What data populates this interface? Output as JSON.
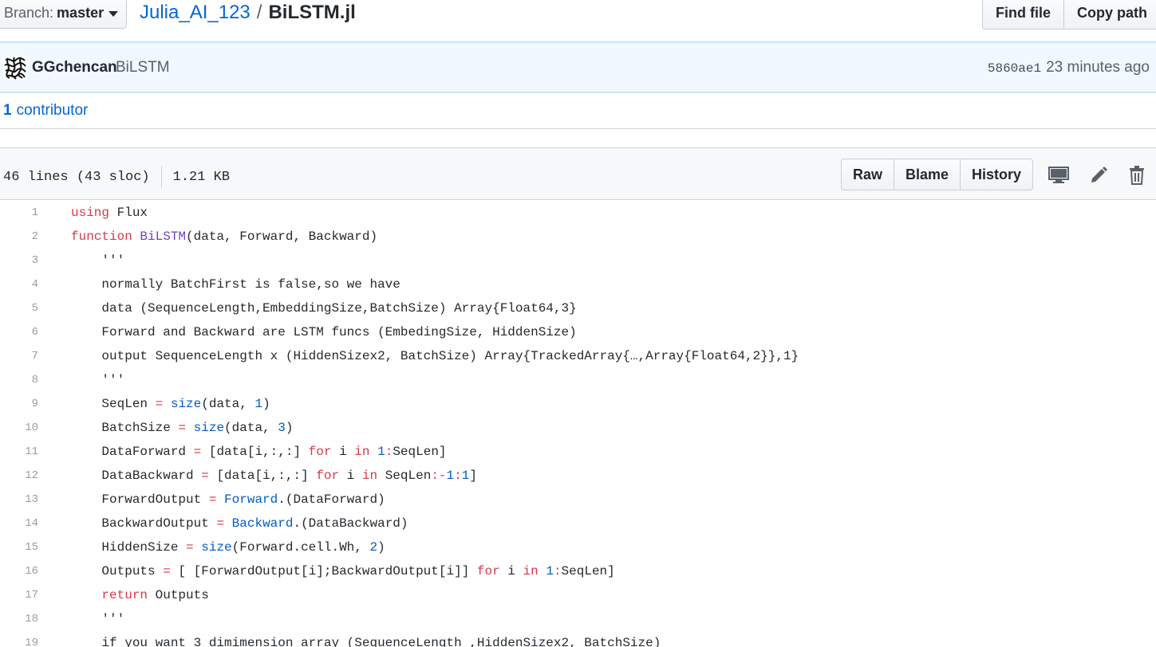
{
  "header": {
    "branch_label": "Branch:",
    "branch_value": "master",
    "repo": "Julia_AI_123",
    "separator": "/",
    "file": "BiLSTM.jl",
    "find_file": "Find file",
    "copy_path": "Copy path"
  },
  "commit": {
    "author": "GGchencan",
    "message": "BiLSTM",
    "sha": "5860ae1",
    "time": "23 minutes ago"
  },
  "contributors": {
    "count": "1",
    "label": "contributor"
  },
  "file_header": {
    "lines": "46 lines (43 sloc)",
    "size": "1.21 KB",
    "raw": "Raw",
    "blame": "Blame",
    "history": "History",
    "icons": [
      "desktop-icon",
      "pencil-icon",
      "trash-icon"
    ]
  },
  "colors": {
    "link": "#0366d6",
    "keyword": "#d73a49",
    "function": "#6f42c1",
    "constant": "#005cc5",
    "commit_bg": "#f1f8ff"
  },
  "code_lines": [
    [
      {
        "t": "k",
        "v": "using"
      },
      {
        "t": "",
        "v": " Flux"
      }
    ],
    [
      {
        "t": "k",
        "v": "function"
      },
      {
        "t": "",
        "v": " "
      },
      {
        "t": "f",
        "v": "BiLSTM"
      },
      {
        "t": "",
        "v": "(data, Forward, Backward)"
      }
    ],
    [
      {
        "t": "",
        "v": "    '''"
      }
    ],
    [
      {
        "t": "",
        "v": "    normally BatchFirst is false,so we have"
      }
    ],
    [
      {
        "t": "",
        "v": "    data (SequenceLength,EmbeddingSize,BatchSize) Array{Float64,3}"
      }
    ],
    [
      {
        "t": "",
        "v": "    Forward and Backward are LSTM funcs (EmbedingSize, HiddenSize)"
      }
    ],
    [
      {
        "t": "",
        "v": "    output SequenceLength x (HiddenSizex2, BatchSize) Array{TrackedArray{…,Array{Float64,2}},1}"
      }
    ],
    [
      {
        "t": "",
        "v": "    '''"
      }
    ],
    [
      {
        "t": "",
        "v": "    SeqLen "
      },
      {
        "t": "k",
        "v": "="
      },
      {
        "t": "",
        "v": " "
      },
      {
        "t": "c",
        "v": "size"
      },
      {
        "t": "",
        "v": "(data, "
      },
      {
        "t": "c",
        "v": "1"
      },
      {
        "t": "",
        "v": ")"
      }
    ],
    [
      {
        "t": "",
        "v": "    BatchSize "
      },
      {
        "t": "k",
        "v": "="
      },
      {
        "t": "",
        "v": " "
      },
      {
        "t": "c",
        "v": "size"
      },
      {
        "t": "",
        "v": "(data, "
      },
      {
        "t": "c",
        "v": "3"
      },
      {
        "t": "",
        "v": ")"
      }
    ],
    [
      {
        "t": "",
        "v": "    DataForward "
      },
      {
        "t": "k",
        "v": "="
      },
      {
        "t": "",
        "v": " [data[i,:,:] "
      },
      {
        "t": "k",
        "v": "for"
      },
      {
        "t": "",
        "v": " i "
      },
      {
        "t": "k",
        "v": "in"
      },
      {
        "t": "",
        "v": " "
      },
      {
        "t": "c",
        "v": "1"
      },
      {
        "t": "k",
        "v": ":"
      },
      {
        "t": "",
        "v": "SeqLen]"
      }
    ],
    [
      {
        "t": "",
        "v": "    DataBackward "
      },
      {
        "t": "k",
        "v": "="
      },
      {
        "t": "",
        "v": " [data[i,:,:] "
      },
      {
        "t": "k",
        "v": "for"
      },
      {
        "t": "",
        "v": " i "
      },
      {
        "t": "k",
        "v": "in"
      },
      {
        "t": "",
        "v": " SeqLen"
      },
      {
        "t": "k",
        "v": ":-"
      },
      {
        "t": "c",
        "v": "1"
      },
      {
        "t": "k",
        "v": ":"
      },
      {
        "t": "c",
        "v": "1"
      },
      {
        "t": "",
        "v": "]"
      }
    ],
    [
      {
        "t": "",
        "v": "    ForwardOutput "
      },
      {
        "t": "k",
        "v": "="
      },
      {
        "t": "",
        "v": " "
      },
      {
        "t": "c",
        "v": "Forward"
      },
      {
        "t": "",
        "v": ".(DataForward)"
      }
    ],
    [
      {
        "t": "",
        "v": "    BackwardOutput "
      },
      {
        "t": "k",
        "v": "="
      },
      {
        "t": "",
        "v": " "
      },
      {
        "t": "c",
        "v": "Backward"
      },
      {
        "t": "",
        "v": ".(DataBackward)"
      }
    ],
    [
      {
        "t": "",
        "v": "    HiddenSize "
      },
      {
        "t": "k",
        "v": "="
      },
      {
        "t": "",
        "v": " "
      },
      {
        "t": "c",
        "v": "size"
      },
      {
        "t": "",
        "v": "(Forward.cell.Wh, "
      },
      {
        "t": "c",
        "v": "2"
      },
      {
        "t": "",
        "v": ")"
      }
    ],
    [
      {
        "t": "",
        "v": "    Outputs "
      },
      {
        "t": "k",
        "v": "="
      },
      {
        "t": "",
        "v": " [ [ForwardOutput[i];BackwardOutput[i]] "
      },
      {
        "t": "k",
        "v": "for"
      },
      {
        "t": "",
        "v": " i "
      },
      {
        "t": "k",
        "v": "in"
      },
      {
        "t": "",
        "v": " "
      },
      {
        "t": "c",
        "v": "1"
      },
      {
        "t": "k",
        "v": ":"
      },
      {
        "t": "",
        "v": "SeqLen]"
      }
    ],
    [
      {
        "t": "",
        "v": "    "
      },
      {
        "t": "k",
        "v": "return"
      },
      {
        "t": "",
        "v": " Outputs"
      }
    ],
    [
      {
        "t": "",
        "v": "    '''"
      }
    ],
    [
      {
        "t": "",
        "v": "    if you want 3 dimimension array (SequenceLength ,HiddenSizex2, BatchSize)"
      }
    ]
  ]
}
